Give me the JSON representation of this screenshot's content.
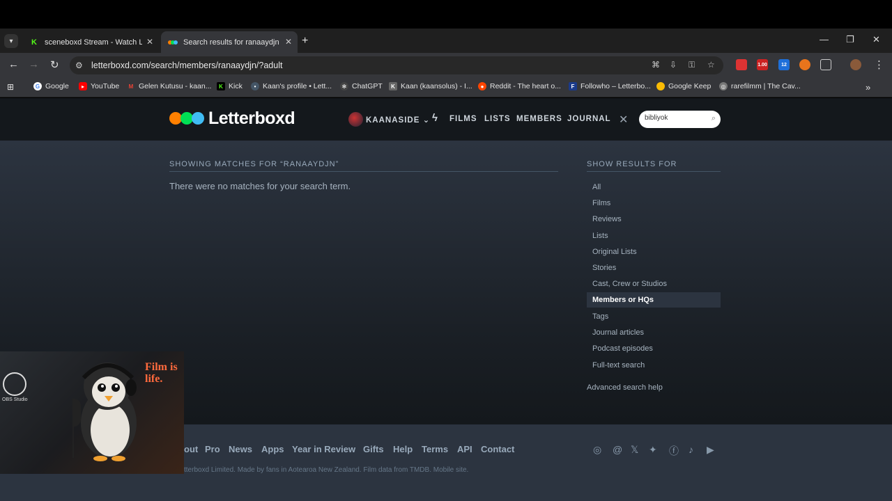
{
  "browser": {
    "tabs": [
      {
        "title": "sceneboxd Stream - Watch Live",
        "icon": "kick-icon",
        "active": false
      },
      {
        "title": "Search results for ranaaydjn • Letterboxd",
        "icon": "letterboxd-icon",
        "active": true
      }
    ],
    "url": "letterboxd.com/search/members/ranaaydjn/?adult",
    "extension_badges": [
      "1.00",
      "12"
    ],
    "bookmarks": [
      "Google",
      "YouTube",
      "Gelen Kutusu - kaan...",
      "Kick",
      "Kaan's profile • Lett...",
      "ChatGPT",
      "Kaan (kaansolus) - I...",
      "Reddit - The heart o...",
      "Followho – Letterbo...",
      "Google Keep",
      "rarefilmm | The Cav..."
    ]
  },
  "site": {
    "logo": "Letterboxd",
    "username": "KAANASIDE",
    "nav": [
      "FILMS",
      "LISTS",
      "MEMBERS",
      "JOURNAL"
    ],
    "search_value": "bibliyok",
    "colors": {
      "orange": "#ff8000",
      "green": "#00e054",
      "blue": "#40bcf4",
      "bg": "#14181c"
    }
  },
  "results": {
    "heading": "SHOWING MATCHES FOR “RANAAYDJN”",
    "message": "There were no matches for your search term."
  },
  "sidebar": {
    "heading": "SHOW RESULTS FOR",
    "filters": [
      "All",
      "Films",
      "Reviews",
      "Lists",
      "Original Lists",
      "Stories",
      "Cast, Crew or Studios",
      "Members or HQs",
      "Tags",
      "Journal articles",
      "Podcast episodes",
      "Full-text search"
    ],
    "active_filter": "Members or HQs",
    "advanced": "Advanced search help"
  },
  "footer": {
    "links": [
      "out",
      "Pro",
      "News",
      "Apps",
      "Year in Review",
      "Gifts",
      "Help",
      "Terms",
      "API",
      "Contact"
    ],
    "copyright": "tterboxd Limited. Made by fans in Aotearoa New Zealand. Film data from TMDB. Mobile site.",
    "social": [
      "instagram-icon",
      "threads-icon",
      "x-icon",
      "bluesky-icon",
      "facebook-icon",
      "tiktok-icon",
      "youtube-icon"
    ]
  },
  "overlay": {
    "text_line1": "Film is",
    "text_line2": "life.",
    "obs_label": "OBS Studio"
  }
}
